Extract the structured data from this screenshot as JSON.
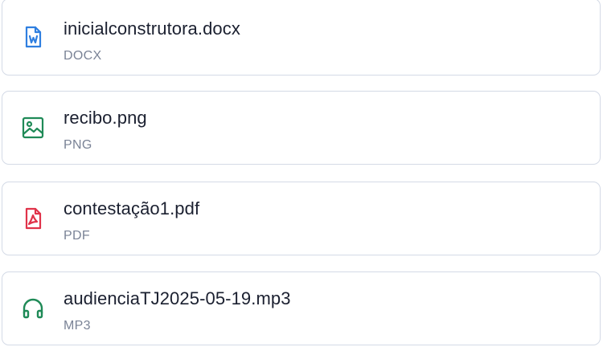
{
  "files": [
    {
      "name": "inicialconstrutora.docx",
      "type": "DOCX",
      "icon": "word-document-icon",
      "color": "#2f7fe0"
    },
    {
      "name": "recibo.png",
      "type": "PNG",
      "icon": "image-file-icon",
      "color": "#1f8a57"
    },
    {
      "name": "contestação1.pdf",
      "type": "PDF",
      "icon": "pdf-file-icon",
      "color": "#e0334a"
    },
    {
      "name": "audienciaTJ2025-05-19.mp3",
      "type": "MP3",
      "icon": "headphones-icon",
      "color": "#1f8a57"
    }
  ]
}
